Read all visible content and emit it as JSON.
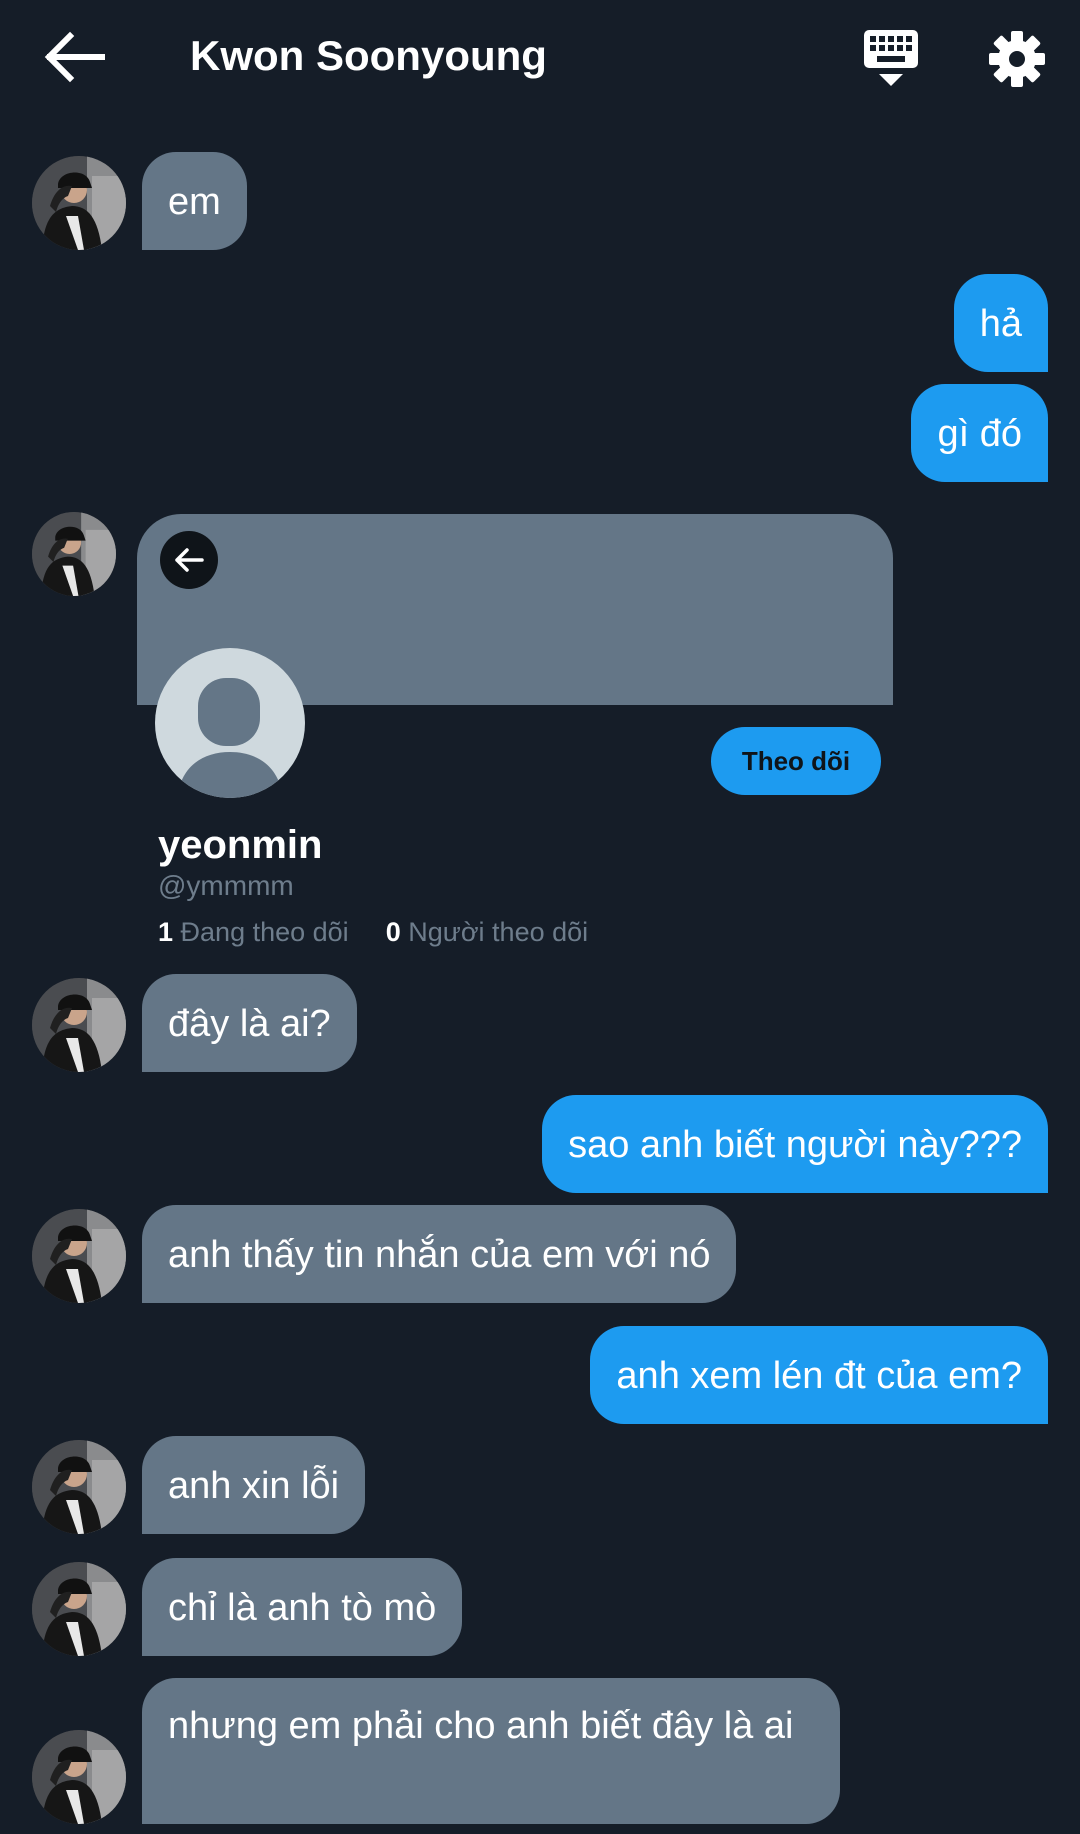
{
  "header": {
    "title": "Kwon Soonyoung",
    "back_icon": "arrow-left-icon",
    "keyboard_icon": "keyboard-icon",
    "settings_icon": "gear-icon"
  },
  "messages": [
    {
      "side": "in",
      "text": "em"
    },
    {
      "side": "out",
      "text": "hả"
    },
    {
      "side": "out",
      "text": "gì đó"
    },
    {
      "side": "in",
      "text": "đây là ai?"
    },
    {
      "side": "out",
      "text": "sao anh biết người này???"
    },
    {
      "side": "in",
      "text": "anh thấy tin nhắn của em với nó"
    },
    {
      "side": "out",
      "text": "anh xem lén đt của em?"
    },
    {
      "side": "in",
      "text": "anh xin lỗi"
    },
    {
      "side": "in",
      "text": "chỉ là anh tò mò"
    },
    {
      "side": "in",
      "text": "nhưng em phải cho anh biết đây là ai"
    }
  ],
  "profile_card": {
    "name": "yeonmin",
    "handle": "@ymmmm",
    "following_count": "1",
    "following_label": "Đang theo dõi",
    "followers_count": "0",
    "followers_label": "Người theo dõi",
    "follow_button": "Theo dõi"
  },
  "colors": {
    "background": "#151d28",
    "incoming_bubble": "#647687",
    "outgoing_bubble": "#1d9bf0",
    "muted_text": "#6e7d8c"
  }
}
